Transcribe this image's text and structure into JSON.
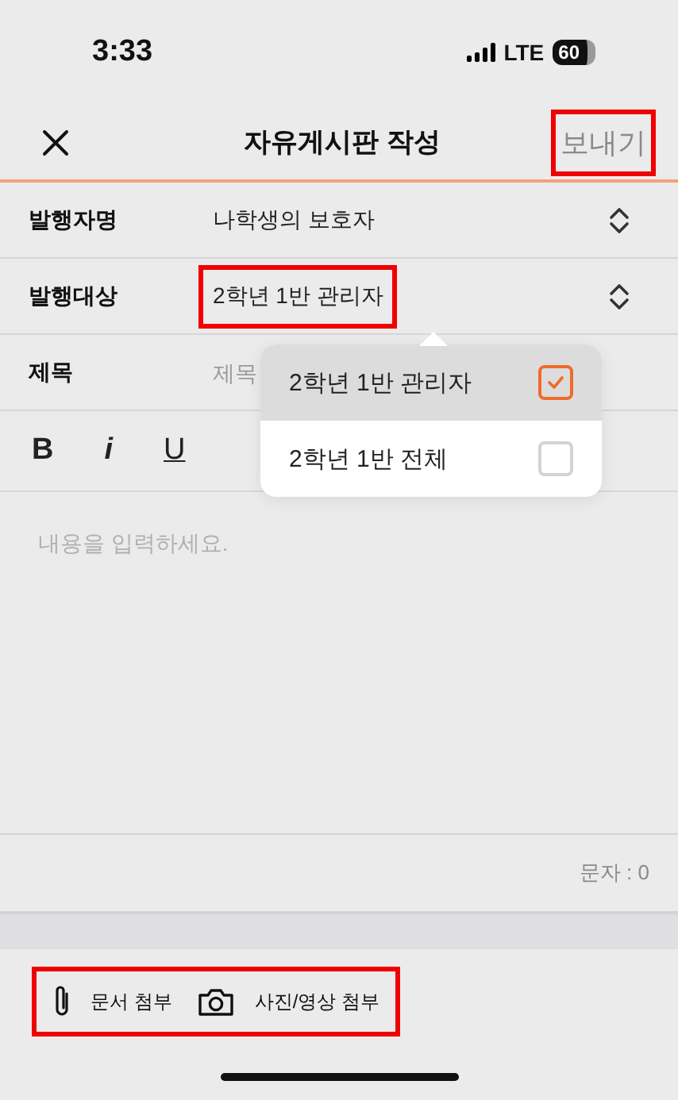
{
  "status_bar": {
    "time": "3:33",
    "network": "LTE",
    "battery": "60"
  },
  "nav": {
    "title": "자유게시판 작성",
    "send": {
      "label": "보내기",
      "disabled": true,
      "highlighted": true
    }
  },
  "fields": [
    {
      "kind": "select",
      "label": "발행자명",
      "value": "나학생의 보호자",
      "highlighted": false
    },
    {
      "kind": "select",
      "label": "발행대상",
      "value": "2학년 1반 관리자",
      "highlighted": true
    },
    {
      "kind": "text",
      "label": "제목",
      "placeholder": "제목"
    }
  ],
  "toolbar": [
    {
      "kind": "bold",
      "label": "B"
    },
    {
      "kind": "italic",
      "label": "i"
    },
    {
      "kind": "underline",
      "label": "U"
    }
  ],
  "dropdown": {
    "options": [
      {
        "label": "2학년 1반 관리자",
        "selected": true
      },
      {
        "label": "2학년 1반 전체",
        "selected": false
      }
    ]
  },
  "editor": {
    "placeholder": "내용을 입력하세요.",
    "counter": "문자 : 0"
  },
  "attachments": {
    "highlighted": true,
    "items": [
      {
        "kind": "document",
        "label": "문서 첨부"
      },
      {
        "kind": "photo",
        "label": "사진/영상 첨부"
      }
    ]
  }
}
